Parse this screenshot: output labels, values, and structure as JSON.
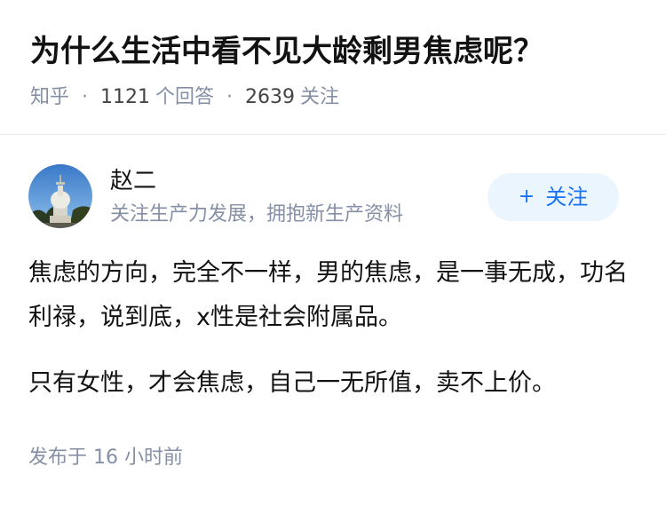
{
  "question": {
    "title": "为什么生活中看不见大龄剩男焦虑呢？",
    "source": "知乎",
    "answers_count": "1121",
    "answers_label": "个回答",
    "followers_count": "2639",
    "followers_label": "关注"
  },
  "answer": {
    "author": {
      "name": "赵二",
      "bio": "关注生产力发展，拥抱新生产资料"
    },
    "follow_button": {
      "plus": "+",
      "label": "关注"
    },
    "paragraphs": [
      "焦虑的方向，完全不一样，男的焦虑，是一事无成，功名利禄，说到底，x性是社会附属品。",
      "只有女性，才会焦虑，自己一无所值，卖不上价。"
    ],
    "publish_time": "发布于 16 小时前"
  },
  "colors": {
    "accent": "#1772f6",
    "follow_bg": "#ebf5fd",
    "meta": "#8590a6"
  }
}
